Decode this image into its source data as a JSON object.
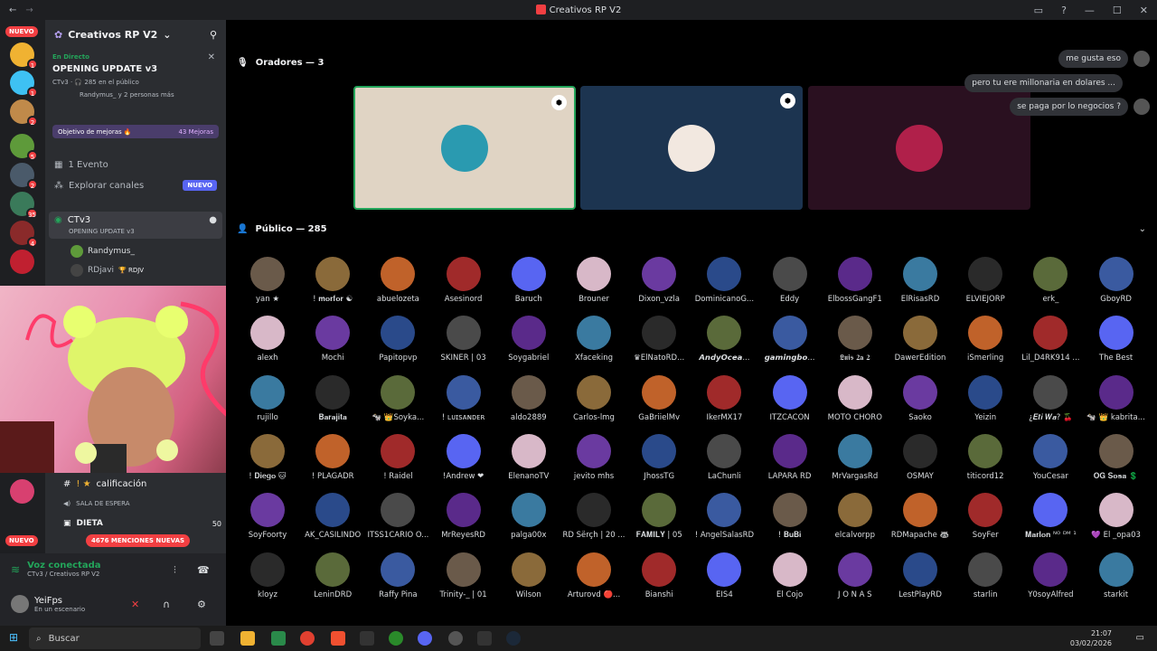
{
  "window": {
    "title": "Creativos RP V2"
  },
  "servers": {
    "new_label": "NUEVO",
    "badges": [
      "1",
      "1",
      "2",
      "5",
      "2",
      "35",
      "4"
    ],
    "mentions_new": "NUEVO"
  },
  "channels": {
    "server_name": "Creativos RP V2",
    "live": {
      "status": "En Directo",
      "title": "OPENING UPDATE v3",
      "meta": "CTv3 · 🎧 285 en el público",
      "people": "Randymus_ y 2 personas más"
    },
    "boost": {
      "label": "Objetivo de mejoras 🔥",
      "count": "43 Mejoras"
    },
    "events": "1 Evento",
    "explore": "Explorar canales",
    "explore_badge": "NUEVO",
    "voice_channel": {
      "name": "CTv3",
      "subtitle": "OPENING UPDATE v3"
    },
    "voice_users": [
      {
        "name": "Randymus_"
      },
      {
        "name": "RDjavi",
        "tag": "🏆 RDJV"
      }
    ],
    "lower": [
      {
        "label": "calificación",
        "prefix": "! ★"
      },
      {
        "label": "SALA DE ESPERA"
      },
      {
        "label": "DIETA",
        "count": "50"
      }
    ],
    "mentions_banner": "4676 MENCIONES NUEVAS"
  },
  "voicebar": {
    "status": "Voz conectada",
    "location": "CTv3 / Creativos RP V2",
    "user": "YeiFps",
    "user_status": "En un escenario"
  },
  "stage": {
    "speakers_label": "Oradores — 3",
    "audience_label": "Público — 285"
  },
  "chat": [
    {
      "text": "me gusta eso"
    },
    {
      "text": "pero tu ere millonaria en dolares ..."
    },
    {
      "text": "se paga por lo negocios ?"
    }
  ],
  "audience": [
    [
      "yan ★",
      "! 𝐦𝐨𝐫𝐟𝐨𝐫 ☯",
      "abuelozeta",
      "Asesinord",
      "Baruch",
      "Brouner",
      "Dixon_vzla",
      "DominicanoG...",
      "Eddy",
      "ElbossGangF1",
      "ElRisasRD",
      "ELVIEJORP",
      "erk_",
      "GboyRD"
    ],
    [
      "alexh",
      "Mochi",
      "Papitopvp",
      "SKINER | 03",
      "Soygabriel",
      "Xfaceking",
      "♛ElNatoRD...",
      "𝘼𝙣𝙙𝙮𝙊𝙘𝙚𝙖...",
      "𝙜𝙖𝙢𝙞𝙣𝙜𝙗𝙤...",
      "𝕷𝖚𝖎𝖘 𝟐𝐚 𝟐",
      "DawerEdition",
      "iSmerling",
      "Lil_D4RK914 ...",
      "The Best"
    ],
    [
      "rujillo",
      "𝐁𝐚𝐫𝐚𝐣𝐢𝐭𝐚",
      "🐄 👑Soyka...",
      "! ʟᴜɪsᴀɴᴅᴇʀ",
      "aldo2889",
      "Carlos-lmg",
      "GaBriielMv",
      "IkerMX17",
      "ITZCACON",
      "MOTO CHORO",
      "Saoko",
      "Yeizin",
      "¿𝑬𝒕𝒊 𝑾𝒂? 🍒",
      "🐄 👑 kabrita..."
    ],
    [
      "! 𝐃𝐢𝐞𝐠𝐨 🐱",
      "! PLAGADR",
      "! Raidel",
      "!Andrew ❤",
      "ElenanoTV",
      "jevito mhs",
      "JhossTG",
      "LaChunli",
      "LAPARA RD",
      "MrVargasRd",
      "OSMAY",
      "titicord12",
      "YouCesar",
      "𝐎𝐆 𝐒𝐨𝐬𝐚 💲"
    ],
    [
      "SoyFoorty",
      "AK_CASILINDO",
      "ITSS1CARIO O...",
      "MrReyesRD",
      "palga00x",
      "RD Šërçh | 20 ...",
      "𝐅𝐀𝐌𝐈𝐋𝐘 | 05",
      "! AngelSalasRD",
      "! 𝐁𝐮𝐁𝐢",
      "elcalvorpp",
      "RDMapache 🦝",
      "SoyFer",
      "𝐌𝐚𝐫𝐥𝐨𝐧 ᴺᴼ ᴰᴹ ¹",
      "💜 El _opa03"
    ],
    [
      "kloyz",
      "LeninDRD",
      "Raffy Pina",
      "Trinity-_ | 01",
      "Wilson",
      "Arturovd 🔴...",
      "Bianshi",
      "EIS4",
      "El Cojo",
      "J O N A S",
      "LestPlayRD",
      "starlin",
      "Y0soyAlfred",
      "starkit"
    ]
  ],
  "taskbar": {
    "search": "Buscar",
    "time": "21:07",
    "date": "03/02/2026"
  },
  "colors": {
    "accent": "#5865f2",
    "danger": "#f23f42",
    "online": "#23a55a",
    "boost": "#4a3d6b"
  }
}
